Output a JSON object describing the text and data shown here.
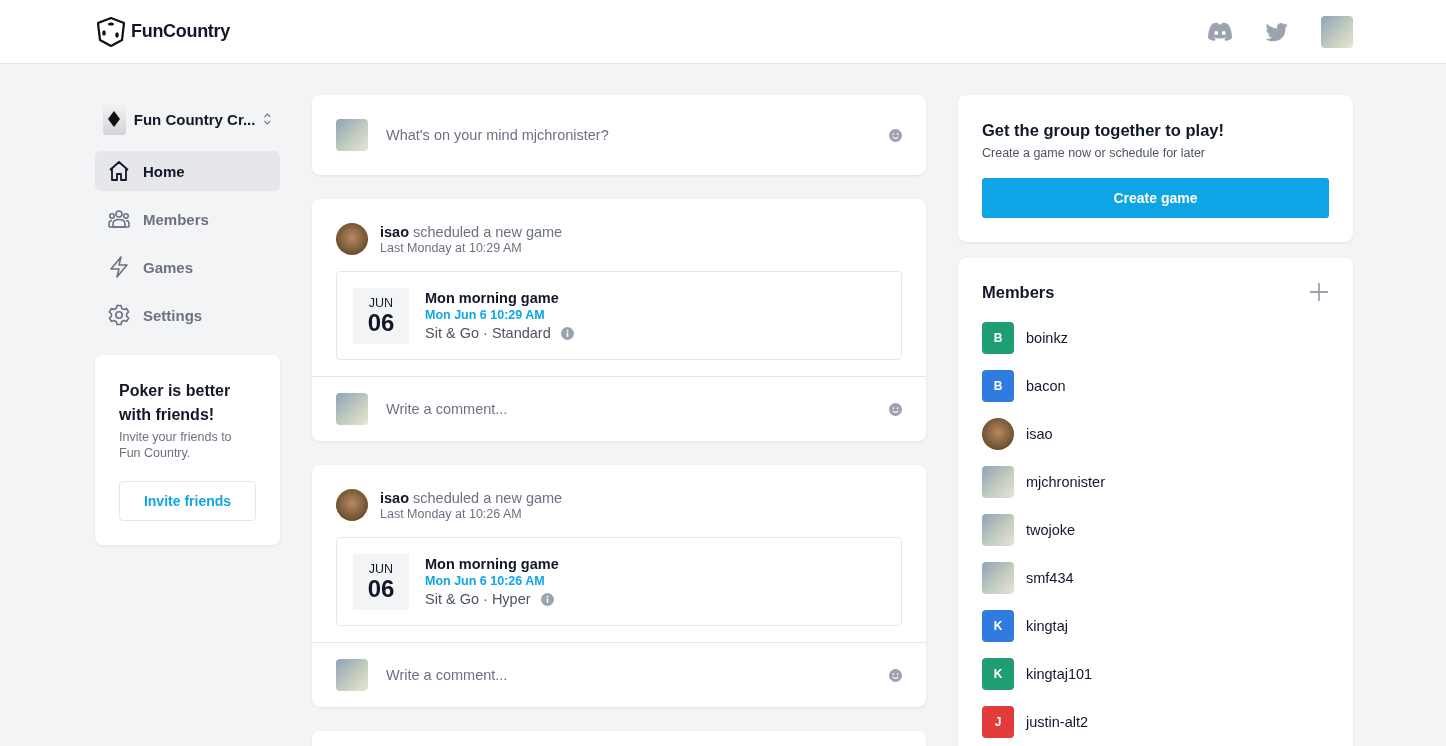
{
  "header": {
    "logo_text": "FunCountry"
  },
  "sidebar": {
    "group": {
      "name": "Fun Country Cr..."
    },
    "nav": [
      {
        "label": "Home",
        "selected": true
      },
      {
        "label": "Members",
        "selected": false
      },
      {
        "label": "Games",
        "selected": false
      },
      {
        "label": "Settings",
        "selected": false
      }
    ],
    "promo": {
      "title": "Poker is better with friends!",
      "text": "Invite your friends to Fun Country.",
      "button": "Invite friends"
    }
  },
  "composer": {
    "placeholder": "What's on your mind mjchronister?"
  },
  "posts": [
    {
      "author": "isao",
      "action": "scheduled a new game",
      "time": "Last Monday at 10:29 AM",
      "event": {
        "month": "JUN",
        "day": "06",
        "title": "Mon morning game",
        "when": "Mon Jun 6 10:29 AM",
        "type": "Sit & Go · Standard"
      },
      "comment_placeholder": "Write a comment..."
    },
    {
      "author": "isao",
      "action": "scheduled a new game",
      "time": "Last Monday at 10:26 AM",
      "event": {
        "month": "JUN",
        "day": "06",
        "title": "Mon morning game",
        "when": "Mon Jun 6 10:26 AM",
        "type": "Sit & Go · Hyper"
      },
      "comment_placeholder": "Write a comment..."
    }
  ],
  "play_card": {
    "title": "Get the group together to play!",
    "subtitle": "Create a game now or schedule for later",
    "button": "Create game"
  },
  "members": {
    "title": "Members",
    "items": [
      {
        "name": "boinkz",
        "kind": "letter",
        "initial": "B",
        "color": "#1f9d74"
      },
      {
        "name": "bacon",
        "kind": "letter",
        "initial": "B",
        "color": "#2f7be0"
      },
      {
        "name": "isao",
        "kind": "round-photo"
      },
      {
        "name": "mjchronister",
        "kind": "photo"
      },
      {
        "name": "twojoke",
        "kind": "photo"
      },
      {
        "name": "smf434",
        "kind": "photo"
      },
      {
        "name": "kingtaj",
        "kind": "letter",
        "initial": "K",
        "color": "#2f7be0"
      },
      {
        "name": "kingtaj101",
        "kind": "letter",
        "initial": "K",
        "color": "#1f9d74"
      },
      {
        "name": "justin-alt2",
        "kind": "letter",
        "initial": "J",
        "color": "#e23b3b"
      }
    ]
  }
}
